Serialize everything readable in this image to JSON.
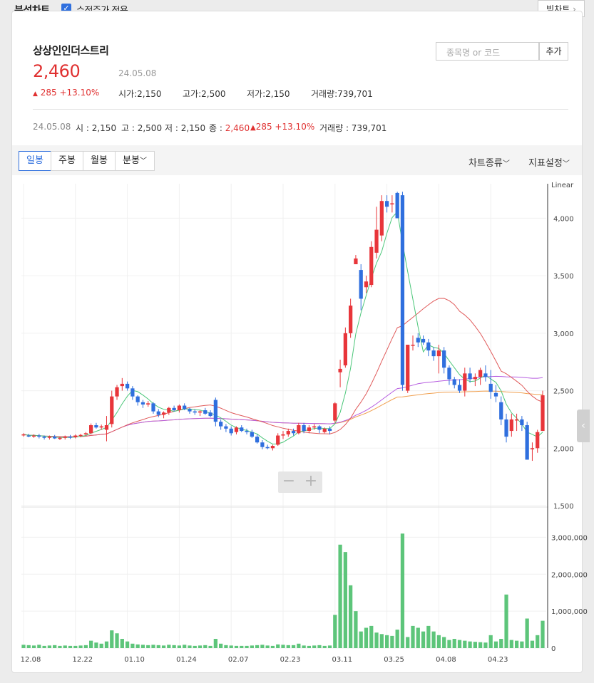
{
  "header": {
    "title": "분석차트",
    "checkbox_label": "수정주가 적용",
    "big_chart_label": "빅차트",
    "big_chart_arrow": "›"
  },
  "stock": {
    "name": "상상인인더스트리",
    "price": "2,460",
    "date": "24.05.08",
    "change": "285 +13.10%",
    "open_label": "시가",
    "open": "2,150",
    "high_label": "고가",
    "high": "2,500",
    "low_label": "저가",
    "low": "2,150",
    "volume_label": "거래량",
    "volume": "739,701"
  },
  "search": {
    "placeholder": "종목명 or 코드",
    "add_label": "추가"
  },
  "detail_line": {
    "date": "24.05.08",
    "o_label": "시",
    "o": "2,150",
    "h_label": "고",
    "h": "2,500",
    "l_label": "저",
    "l": "2,150",
    "c_label": "종",
    "c": "2,460",
    "change": "285 +13.10%",
    "vol_label": "거래량",
    "vol": "739,701"
  },
  "tabs": [
    {
      "label": "일봉",
      "active": true
    },
    {
      "label": "주봉",
      "active": false
    },
    {
      "label": "월봉",
      "active": false
    },
    {
      "label": "분봉",
      "active": false
    }
  ],
  "right_menu": {
    "chart_type": "차트종류",
    "indicator": "지표설정"
  },
  "zoom": {
    "minus": "−",
    "plus": "+"
  },
  "colors": {
    "up": "#e8353a",
    "down": "#2f6fde",
    "volume": "#5dc57a",
    "ma5": "#4cc77a",
    "ma20": "#e05a5a",
    "ma60": "#b65ce0",
    "ma120": "#f0a050"
  },
  "chart_data": {
    "type": "candlestick",
    "scale_label": "Linear",
    "price_ylim": [
      1500,
      4300
    ],
    "price_ticks": [
      "1,500",
      "2,000",
      "2,500",
      "3,000",
      "3,500",
      "4,000"
    ],
    "volume_ylim": [
      0,
      3200000
    ],
    "volume_ticks": [
      "0",
      "1,000,000",
      "2,000,000",
      "3,000,000"
    ],
    "x_tick_labels": [
      "12.08",
      "12.22",
      "01.10",
      "01.24",
      "02.07",
      "02.23",
      "03.11",
      "03.25",
      "04.08",
      "04.23"
    ],
    "x_tick_index": [
      0,
      10,
      20,
      30,
      40,
      50,
      60,
      70,
      80,
      90
    ],
    "candles": [
      [
        2115,
        2130,
        2100,
        2120
      ],
      [
        2110,
        2125,
        2095,
        2105
      ],
      [
        2105,
        2120,
        2090,
        2110
      ],
      [
        2110,
        2125,
        2085,
        2100
      ],
      [
        2100,
        2110,
        2075,
        2090
      ],
      [
        2090,
        2110,
        2075,
        2100
      ],
      [
        2100,
        2115,
        2080,
        2085
      ],
      [
        2085,
        2100,
        2070,
        2090
      ],
      [
        2090,
        2110,
        2075,
        2100
      ],
      [
        2100,
        2115,
        2080,
        2095
      ],
      [
        2095,
        2120,
        2085,
        2110
      ],
      [
        2110,
        2125,
        2095,
        2115
      ],
      [
        2120,
        2140,
        2110,
        2130
      ],
      [
        2130,
        2215,
        2120,
        2200
      ],
      [
        2200,
        2220,
        2170,
        2180
      ],
      [
        2180,
        2205,
        2160,
        2190
      ],
      [
        2160,
        2280,
        2060,
        2200
      ],
      [
        2210,
        2500,
        2180,
        2450
      ],
      [
        2450,
        2550,
        2420,
        2530
      ],
      [
        2540,
        2610,
        2500,
        2560
      ],
      [
        2560,
        2580,
        2500,
        2520
      ],
      [
        2520,
        2540,
        2420,
        2450
      ],
      [
        2450,
        2460,
        2370,
        2400
      ],
      [
        2400,
        2420,
        2350,
        2380
      ],
      [
        2380,
        2410,
        2360,
        2390
      ],
      [
        2390,
        2400,
        2300,
        2320
      ],
      [
        2320,
        2340,
        2270,
        2290
      ],
      [
        2290,
        2320,
        2260,
        2310
      ],
      [
        2310,
        2360,
        2290,
        2350
      ],
      [
        2350,
        2370,
        2320,
        2330
      ],
      [
        2330,
        2380,
        2310,
        2370
      ],
      [
        2370,
        2390,
        2330,
        2340
      ],
      [
        2340,
        2350,
        2300,
        2320
      ],
      [
        2320,
        2340,
        2290,
        2310
      ],
      [
        2310,
        2330,
        2280,
        2320
      ],
      [
        2330,
        2350,
        2290,
        2300
      ],
      [
        2310,
        2330,
        2270,
        2280
      ],
      [
        2420,
        2440,
        2190,
        2230
      ],
      [
        2230,
        2250,
        2160,
        2190
      ],
      [
        2190,
        2210,
        2140,
        2170
      ],
      [
        2170,
        2190,
        2110,
        2130
      ],
      [
        2140,
        2190,
        2120,
        2180
      ],
      [
        2180,
        2200,
        2140,
        2150
      ],
      [
        2150,
        2170,
        2120,
        2140
      ],
      [
        2140,
        2160,
        2090,
        2100
      ],
      [
        2100,
        2120,
        2040,
        2050
      ],
      [
        2050,
        2070,
        1990,
        2010
      ],
      [
        2010,
        2030,
        1990,
        2000
      ],
      [
        2000,
        2030,
        1980,
        2020
      ],
      [
        2030,
        2130,
        2020,
        2110
      ],
      [
        2110,
        2150,
        2080,
        2120
      ],
      [
        2120,
        2170,
        2100,
        2150
      ],
      [
        2150,
        2170,
        2110,
        2130
      ],
      [
        2130,
        2220,
        2120,
        2200
      ],
      [
        2200,
        2220,
        2130,
        2150
      ],
      [
        2150,
        2200,
        2130,
        2180
      ],
      [
        2180,
        2210,
        2160,
        2190
      ],
      [
        2190,
        2200,
        2130,
        2160
      ],
      [
        2140,
        2180,
        2130,
        2170
      ],
      [
        2170,
        2190,
        2120,
        2150
      ],
      [
        2240,
        2400,
        2220,
        2390
      ],
      [
        2660,
        2770,
        2530,
        2690
      ],
      [
        2720,
        3050,
        2700,
        3000
      ],
      [
        3000,
        3300,
        2960,
        3240
      ],
      [
        3600,
        3680,
        3600,
        3650
      ],
      [
        3550,
        3600,
        3200,
        3300
      ],
      [
        3400,
        3500,
        3350,
        3450
      ],
      [
        3420,
        3800,
        3400,
        3750
      ],
      [
        3700,
        4100,
        3650,
        3900
      ],
      [
        3850,
        4200,
        3800,
        4150
      ],
      [
        4150,
        4200,
        4050,
        4100
      ],
      [
        4120,
        4200,
        4050,
        4130
      ],
      [
        4220,
        4230,
        4000,
        4000
      ],
      [
        4200,
        4230,
        2500,
        2550
      ],
      [
        2500,
        2650,
        2480,
        2900
      ],
      [
        2900,
        2980,
        2850,
        2900
      ],
      [
        2960,
        3000,
        2880,
        2920
      ],
      [
        2950,
        2980,
        2900,
        2920
      ],
      [
        2920,
        2950,
        2800,
        2850
      ],
      [
        2850,
        2880,
        2760,
        2800
      ],
      [
        2800,
        2900,
        2650,
        2850
      ],
      [
        2850,
        2880,
        2650,
        2700
      ],
      [
        2700,
        2720,
        2550,
        2600
      ],
      [
        2600,
        2620,
        2520,
        2550
      ],
      [
        2550,
        2600,
        2480,
        2500
      ],
      [
        2500,
        2700,
        2450,
        2650
      ],
      [
        2650,
        2700,
        2570,
        2600
      ],
      [
        2600,
        2650,
        2540,
        2620
      ],
      [
        2620,
        2700,
        2550,
        2680
      ],
      [
        2650,
        2720,
        2580,
        2620
      ],
      [
        2560,
        2680,
        2430,
        2490
      ],
      [
        2480,
        2550,
        2400,
        2450
      ],
      [
        2400,
        2450,
        2200,
        2250
      ],
      [
        2250,
        2300,
        2050,
        2100
      ],
      [
        2150,
        2300,
        2100,
        2250
      ],
      [
        2250,
        2300,
        2150,
        2250
      ],
      [
        2250,
        2280,
        2150,
        2200
      ],
      [
        2200,
        2230,
        1900,
        1900
      ],
      [
        1990,
        2050,
        1890,
        2000
      ],
      [
        2000,
        2160,
        1960,
        2140
      ],
      [
        2150,
        2500,
        2150,
        2460
      ]
    ],
    "volume": [
      90000,
      80000,
      70000,
      90000,
      60000,
      70000,
      80000,
      60000,
      70000,
      60000,
      60000,
      70000,
      80000,
      200000,
      150000,
      120000,
      180000,
      480000,
      400000,
      250000,
      180000,
      120000,
      100000,
      90000,
      80000,
      90000,
      80000,
      70000,
      90000,
      80000,
      70000,
      90000,
      70000,
      60000,
      70000,
      80000,
      60000,
      250000,
      120000,
      80000,
      70000,
      60000,
      60000,
      60000,
      70000,
      80000,
      90000,
      70000,
      60000,
      100000,
      90000,
      80000,
      80000,
      120000,
      70000,
      60000,
      70000,
      80000,
      60000,
      70000,
      900000,
      2800000,
      2600000,
      1700000,
      1000000,
      450000,
      550000,
      600000,
      420000,
      380000,
      350000,
      330000,
      500000,
      3100000,
      300000,
      600000,
      550000,
      450000,
      600000,
      450000,
      350000,
      300000,
      220000,
      250000,
      220000,
      200000,
      180000,
      170000,
      160000,
      150000,
      350000,
      180000,
      250000,
      1450000,
      220000,
      200000,
      180000,
      800000,
      200000,
      350000,
      739701
    ]
  }
}
